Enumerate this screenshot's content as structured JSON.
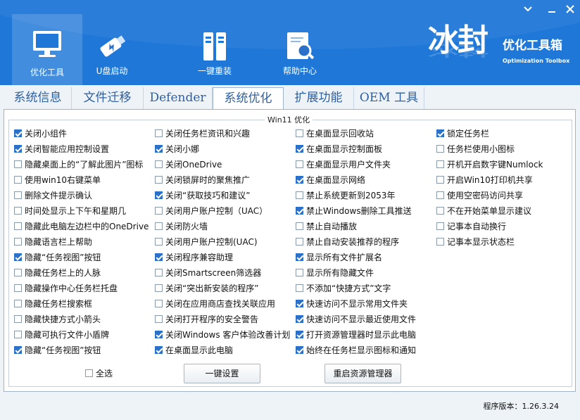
{
  "window": {
    "minimize_label": "minimize",
    "close_label": "close"
  },
  "nav": [
    {
      "label": "优化工具",
      "icon": "monitor-icon",
      "active": true
    },
    {
      "label": "U盘启动",
      "icon": "usb-drive-icon",
      "active": false
    },
    {
      "label": "一键重装",
      "icon": "reinstall-icon",
      "active": false
    },
    {
      "label": "帮助中心",
      "icon": "help-search-icon",
      "active": false
    }
  ],
  "brand": {
    "name": "冰封",
    "subtitle": "优化工具箱",
    "english": "Optimization Toolbox"
  },
  "tabs": [
    {
      "label": "系统信息",
      "active": false
    },
    {
      "label": "文件迁移",
      "active": false
    },
    {
      "label": "Defender",
      "active": false
    },
    {
      "label": "系统优化",
      "active": true
    },
    {
      "label": "扩展功能",
      "active": false
    },
    {
      "label": "OEM 工具",
      "active": false
    }
  ],
  "group_title": "Win11 优化",
  "columns": [
    [
      {
        "label": "关闭小组件",
        "checked": true
      },
      {
        "label": "关闭智能应用控制设置",
        "checked": true
      },
      {
        "label": "隐藏桌面上的“了解此图片”图标",
        "checked": false
      },
      {
        "label": "使用win10右键菜单",
        "checked": false
      },
      {
        "label": "删除文件提示确认",
        "checked": false
      },
      {
        "label": "时间处显示上下午和星期几",
        "checked": false
      },
      {
        "label": "隐藏此电脑左边栏中的OneDrive",
        "checked": false
      },
      {
        "label": "隐藏语言栏上帮助",
        "checked": false
      },
      {
        "label": "隐藏“任务视图”按钮",
        "checked": true
      },
      {
        "label": "隐藏任务栏上的人脉",
        "checked": false
      },
      {
        "label": "隐藏操作中心任务栏托盘",
        "checked": false
      },
      {
        "label": "隐藏任务栏搜索框",
        "checked": false
      },
      {
        "label": "隐藏快捷方式小箭头",
        "checked": false
      },
      {
        "label": "隐藏可执行文件小盾牌",
        "checked": false
      },
      {
        "label": "隐藏“任务视图”按钮",
        "checked": true
      }
    ],
    [
      {
        "label": "关闭任务栏资讯和兴趣",
        "checked": false
      },
      {
        "label": "关闭小娜",
        "checked": true
      },
      {
        "label": "关闭OneDrive",
        "checked": false
      },
      {
        "label": "关闭锁屏时的聚焦推广",
        "checked": false
      },
      {
        "label": "关闭“获取技巧和建议”",
        "checked": true
      },
      {
        "label": "关闭用户账户控制（UAC）",
        "checked": false
      },
      {
        "label": "关闭防火墙",
        "checked": false
      },
      {
        "label": "关闭用户账户控制(UAC)",
        "checked": false
      },
      {
        "label": "关闭程序兼容助理",
        "checked": true
      },
      {
        "label": "关闭Smartscreen筛选器",
        "checked": false
      },
      {
        "label": "关闭“突出新安装的程序”",
        "checked": false
      },
      {
        "label": "关闭在应用商店查找关联应用",
        "checked": false
      },
      {
        "label": "关闭打开程序的安全警告",
        "checked": false
      },
      {
        "label": "关闭Windows 客户体验改善计划",
        "checked": true
      },
      {
        "label": "在桌面显示此电脑",
        "checked": true
      }
    ],
    [
      {
        "label": "在桌面显示回收站",
        "checked": false
      },
      {
        "label": "在桌面显示控制面板",
        "checked": true
      },
      {
        "label": "在桌面显示用户文件夹",
        "checked": false
      },
      {
        "label": "在桌面显示网络",
        "checked": true
      },
      {
        "label": "禁止系统更新到2053年",
        "checked": false
      },
      {
        "label": "禁止Windows删除工具推送",
        "checked": true
      },
      {
        "label": "禁止自动播放",
        "checked": false
      },
      {
        "label": "禁止自动安装推荐的程序",
        "checked": false
      },
      {
        "label": "显示所有文件扩展名",
        "checked": true
      },
      {
        "label": "显示所有隐藏文件",
        "checked": false
      },
      {
        "label": "不添加“快捷方式”文字",
        "checked": false
      },
      {
        "label": "快速访问不显示常用文件夹",
        "checked": true
      },
      {
        "label": "快速访问不显示最近使用文件",
        "checked": true
      },
      {
        "label": "打开资源管理器时显示此电脑",
        "checked": true
      },
      {
        "label": "始终在任务栏显示图标和通知",
        "checked": true
      }
    ],
    [
      {
        "label": "锁定任务栏",
        "checked": true
      },
      {
        "label": "任务栏使用小图标",
        "checked": false
      },
      {
        "label": "开机开启数字键Numlock",
        "checked": false
      },
      {
        "label": "开启Win10打印机共享",
        "checked": false
      },
      {
        "label": "使用空密码访问共享",
        "checked": false
      },
      {
        "label": "不在开始菜单显示建议",
        "checked": false
      },
      {
        "label": "记事本自动换行",
        "checked": false
      },
      {
        "label": "记事本显示状态栏",
        "checked": false
      }
    ]
  ],
  "select_all": {
    "label": "全选",
    "checked": false
  },
  "buttons": {
    "apply": "一键设置",
    "restart_explorer": "重启资源管理器"
  },
  "version": "程序版本：1.26.3.24",
  "colors": {
    "header": "#1f78d8",
    "accent": "#2b71c9",
    "tab_text": "#2d5fa0"
  }
}
